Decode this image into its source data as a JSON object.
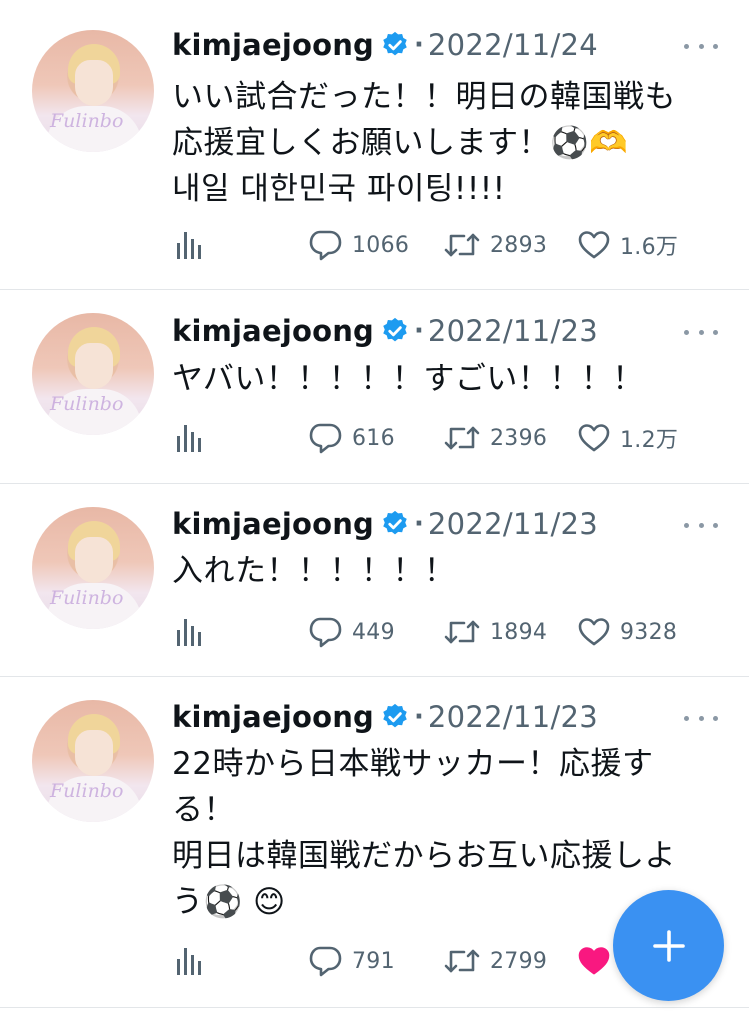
{
  "colors": {
    "accent": "#3a91f2",
    "verified": "#1d9bf0",
    "muted": "#536471",
    "liked": "#f91880"
  },
  "avatar": {
    "watermark": "Fulinbo"
  },
  "tweets": [
    {
      "user": "kimjaejoong",
      "separator": "·",
      "date": "2022/11/24",
      "lines": [
        "いい試合だった！！明日の韓国戦も",
        "応援宜しくお願いします！⚽🫶",
        "내일 대한민국 파이팅!!!!"
      ],
      "replies": "1066",
      "retweets": "2893",
      "likes": "1.6万",
      "liked": false
    },
    {
      "user": "kimjaejoong",
      "separator": "·",
      "date": "2022/11/23",
      "lines": [
        "ヤバい！！！！！すごい！！！！"
      ],
      "replies": "616",
      "retweets": "2396",
      "likes": "1.2万",
      "liked": false
    },
    {
      "user": "kimjaejoong",
      "separator": "·",
      "date": "2022/11/23",
      "lines": [
        "入れた！！！！！！"
      ],
      "replies": "449",
      "retweets": "1894",
      "likes": "9328",
      "liked": false
    },
    {
      "user": "kimjaejoong",
      "separator": "·",
      "date": "2022/11/23",
      "lines": [
        "22時から日本戦サッカー！応援す",
        "る！",
        "明日は韓国戦だからお互い応援しよ",
        "う⚽ 😊"
      ],
      "replies": "791",
      "retweets": "2799",
      "likes": "",
      "liked": true
    }
  ],
  "icons": {
    "more": "more-horizontal-icon",
    "reply": "reply-bubble-icon",
    "retweet": "retweet-icon",
    "like": "heart-icon",
    "analytics": "analytics-bars-icon",
    "compose": "plus-icon"
  }
}
